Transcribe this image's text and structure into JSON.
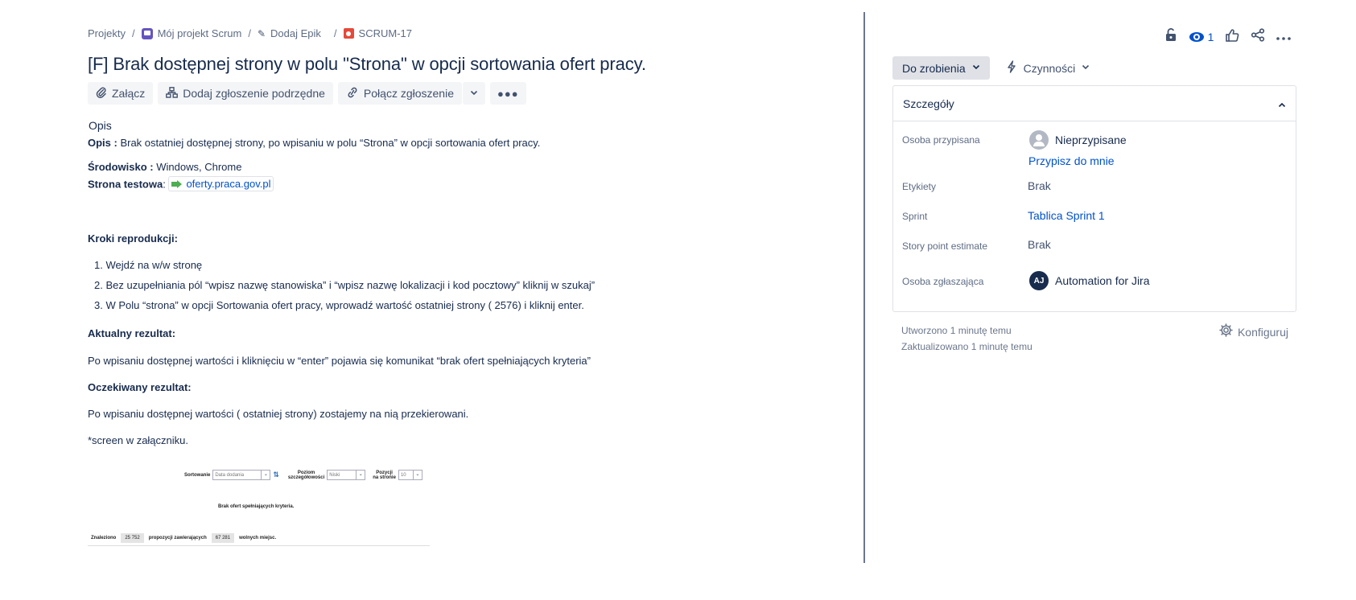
{
  "breadcrumb": {
    "projects": "Projekty",
    "project": "Mój projekt Scrum",
    "epic": "Dodaj Epik",
    "issue_key": "SCRUM-17"
  },
  "issue": {
    "title": "[F] Brak dostępnej strony w polu \"Strona\" w opcji sortowania ofert pracy."
  },
  "toolbar": {
    "attach": "Załącz",
    "add_child": "Dodaj zgłoszenie podrzędne",
    "link_issue": "Połącz zgłoszenie"
  },
  "description": {
    "heading": "Opis",
    "opis_label": "Opis :",
    "opis_text": " Brak ostatniej dostępnej strony, po wpisaniu w polu “Strona” w opcji sortowania ofert pracy.",
    "env_label": "Środowisko :",
    "env_text": " Windows, Chrome",
    "test_label": "Strona testowa",
    "test_colon": ":",
    "test_link": "oferty.praca.gov.pl",
    "steps_heading": "Kroki reprodukcji:",
    "steps": [
      "1. Wejdź na w/w stronę",
      "2. Bez uzupełniania pól “wpisz nazwę stanowiska” i “wpisz nazwę lokalizacji i kod pocztowy” kliknij w szukaj”",
      "3. W Polu “strona” w opcji Sortowania ofert pracy, wprowadź wartość ostatniej strony ( 2576) i kliknij enter."
    ],
    "actual_heading": "Aktualny rezultat:",
    "actual_text": "Po wpisaniu dostępnej wartości i kliknięciu w “enter” pojawia się komunikat “brak ofert spełniających kryteria”",
    "expected_heading": "Oczekiwany rezultat:",
    "expected_text": "Po wpisaniu dostępnej wartości ( ostatniej strony) zostajemy na nią przekierowani.",
    "screen_note": "*screen w załączniku."
  },
  "attachment": {
    "sort_label": "Sortowanie",
    "sort_value": "Data dodania",
    "level_label_1": "Poziom",
    "level_label_2": "szczegółowości",
    "level_value": "Niski",
    "per_page_label_1": "Pozycji",
    "per_page_label_2": "na stronie",
    "per_page_value": "10",
    "no_results": "Brak ofert spełniających kryteria.",
    "found_label": "Znaleziono",
    "found_count": "25 752",
    "proposals_label": "propozycji zawierających",
    "positions_count": "67 281",
    "positions_label": "wolnych miejsc."
  },
  "sidebar": {
    "watch_count": "1",
    "status": "Do zrobienia",
    "actions": "Czynności",
    "details_heading": "Szczegóły",
    "fields": {
      "assignee_label": "Osoba przypisana",
      "assignee_value": "Nieprzypisane",
      "assign_to_me": "Przypisz do mnie",
      "labels_label": "Etykiety",
      "labels_value": "Brak",
      "sprint_label": "Sprint",
      "sprint_value": "Tablica Sprint 1",
      "story_points_label": "Story point estimate",
      "story_points_value": "Brak",
      "reporter_label": "Osoba zgłaszająca",
      "reporter_initials": "AJ",
      "reporter_value": "Automation for Jira"
    },
    "created": "Utworzono 1 minutę temu",
    "updated": "Zaktualizowano 1 minutę temu",
    "configure": "Konfiguruj"
  },
  "icons": {
    "attach": "paperclip-icon",
    "child": "hierarchy-icon",
    "link": "link-icon",
    "lock": "unlock-icon",
    "watch": "eye-icon",
    "like": "thumbs-up-icon",
    "share": "share-icon",
    "more": "more-icon",
    "settings": "gear-icon"
  },
  "colors": {
    "link": "#0052cc",
    "text": "#172b4d",
    "bug": "#e5493a",
    "project": "#6554c0",
    "status_bg": "#dfe1e6"
  }
}
